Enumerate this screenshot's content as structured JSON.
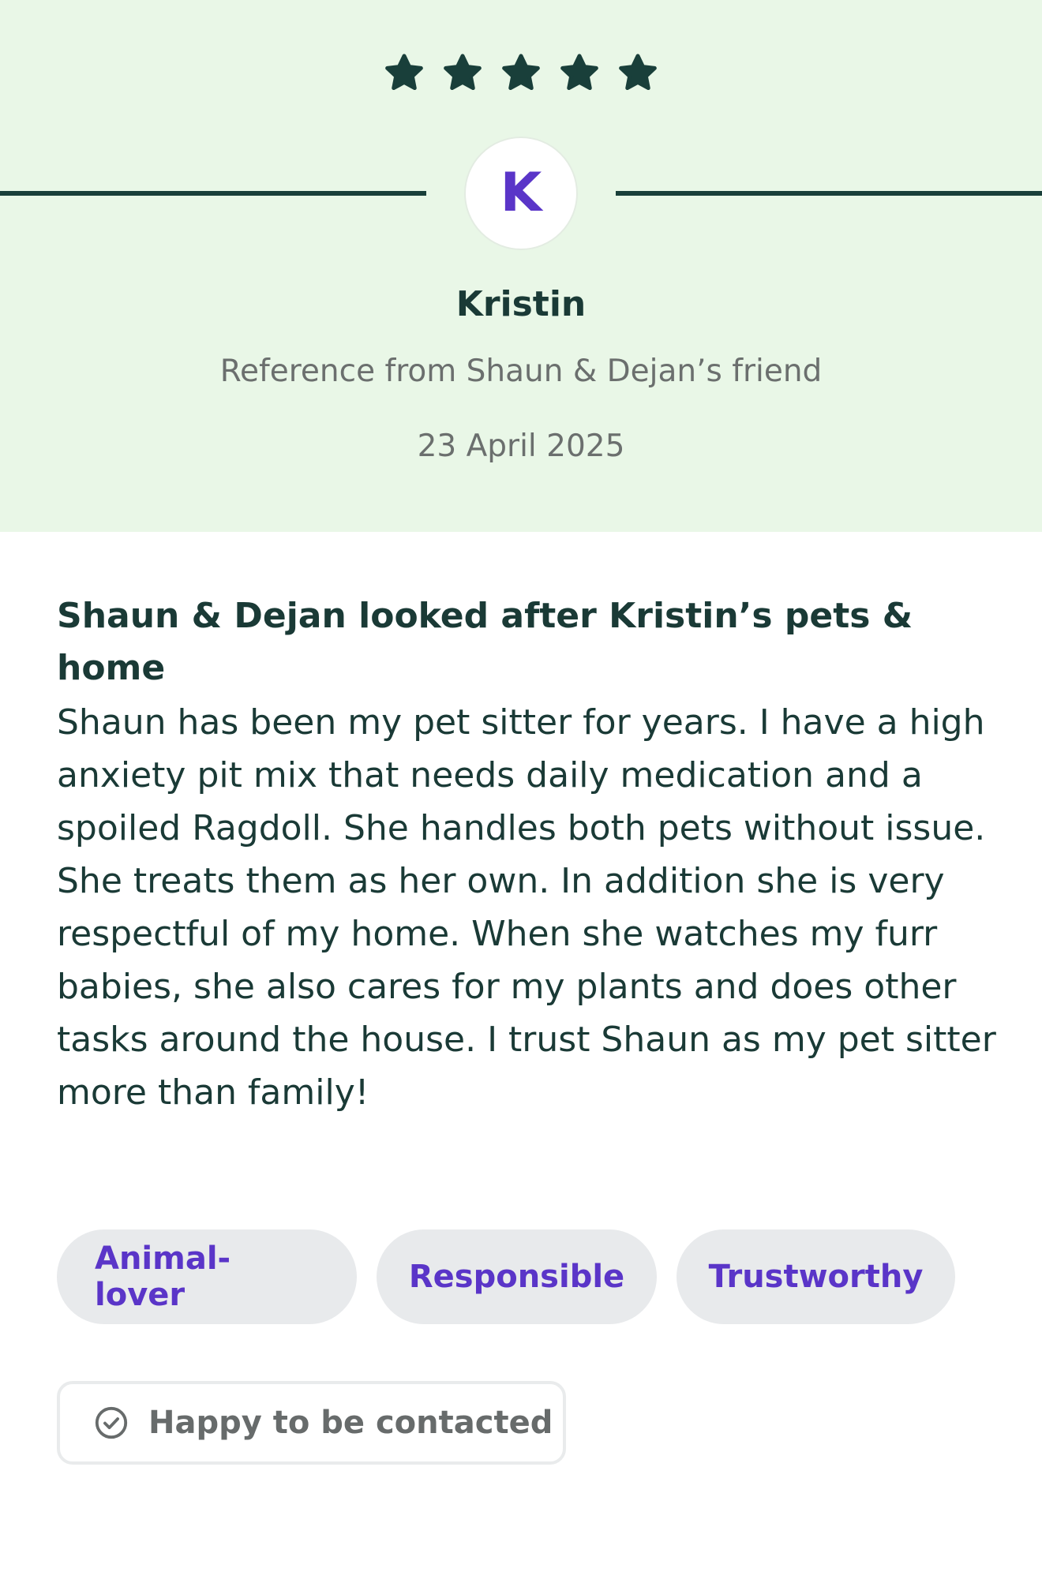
{
  "rating": {
    "stars": 5,
    "star_color": "#193f3a",
    "icon": "star-icon"
  },
  "reviewer": {
    "initial": "K",
    "name": "Kristin",
    "reference_line": "Reference from Shaun & Dejan’s friend",
    "date": "23 April 2025"
  },
  "review": {
    "heading": "Shaun & Dejan looked after Kristin’s pets & home",
    "body": "Shaun has been my pet sitter for years. I have a high anxiety pit mix that needs daily medication and a spoiled Ragdoll. She handles both pets without issue. She treats them as her own. In addition she is very respectful of my home. When she watches my furr babies, she also cares for my plants and does other tasks around the house. I trust Shaun as my pet sitter more than family!"
  },
  "tags": [
    {
      "label": "Animal-lover"
    },
    {
      "label": "Responsible"
    },
    {
      "label": "Trustworthy"
    }
  ],
  "contact": {
    "label": "Happy to be contacted",
    "icon": "check-circle-icon"
  },
  "colors": {
    "header_bg": "#e9f7e7",
    "accent_purple": "#5a35c8",
    "text_dark": "#1a3a36",
    "text_muted": "#6b6f6e"
  }
}
